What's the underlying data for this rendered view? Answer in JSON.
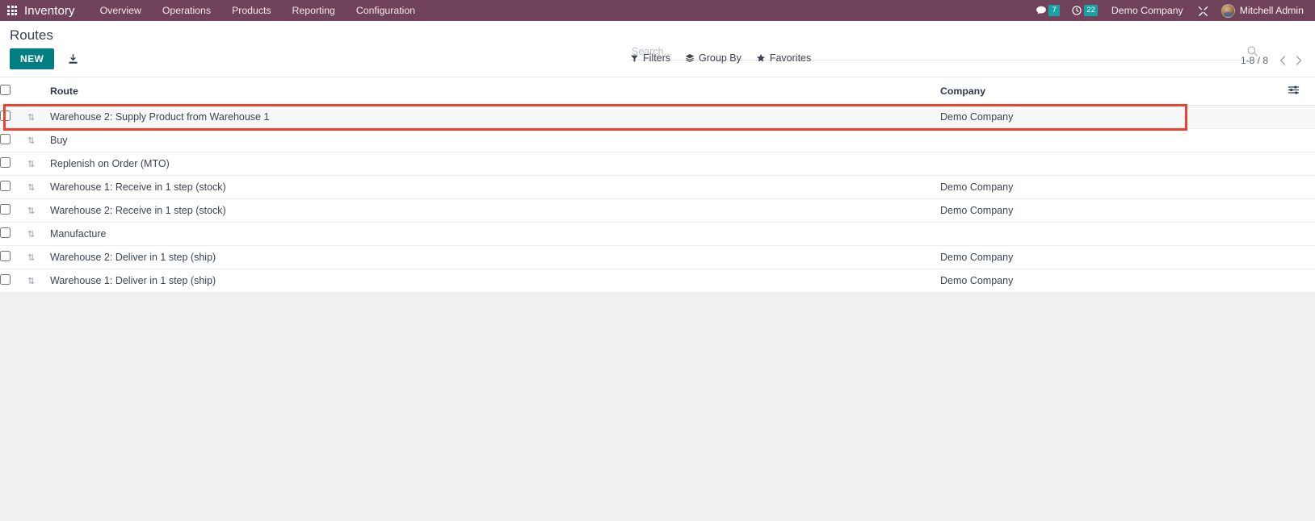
{
  "navbar": {
    "apps_icon": "apps-grid-icon",
    "brand": "Inventory",
    "menu": [
      {
        "label": "Overview"
      },
      {
        "label": "Operations"
      },
      {
        "label": "Products"
      },
      {
        "label": "Reporting"
      },
      {
        "label": "Configuration"
      }
    ],
    "messages": {
      "icon": "chat-bubble-icon",
      "count": "7"
    },
    "activities": {
      "icon": "clock-icon",
      "count": "22"
    },
    "company": "Demo Company",
    "debug": {
      "icon": "tools-wrench-icon"
    },
    "user": {
      "avatar": "user-avatar",
      "name": "Mitchell Admin"
    },
    "background_color": "#71435a",
    "badge_color": "#17a2a8"
  },
  "control_panel": {
    "title": "Routes",
    "new_button": "NEW",
    "new_button_color": "#017e84",
    "upload_icon": "upload-import-icon",
    "search": {
      "placeholder": "Search...",
      "value": "",
      "icon": "search-icon"
    },
    "filters": [
      {
        "label": "Filters",
        "icon": "funnel-icon"
      },
      {
        "label": "Group By",
        "icon": "layers-icon"
      },
      {
        "label": "Favorites",
        "icon": "star-icon"
      }
    ],
    "pager": {
      "range": "1-8 / 8",
      "prev_icon": "chevron-left-icon",
      "next_icon": "chevron-right-icon"
    }
  },
  "list": {
    "columns": {
      "route": "Route",
      "company": "Company"
    },
    "optional_columns_icon": "column-options-icon",
    "select_all_checkbox": false,
    "rows": [
      {
        "route": "Warehouse 2: Supply Product from Warehouse 1",
        "company": "Demo Company",
        "selected": false,
        "highlighted": true
      },
      {
        "route": "Buy",
        "company": "",
        "selected": false,
        "highlighted": false
      },
      {
        "route": "Replenish on Order (MTO)",
        "company": "",
        "selected": false,
        "highlighted": false
      },
      {
        "route": "Warehouse 1: Receive in 1 step (stock)",
        "company": "Demo Company",
        "selected": false,
        "highlighted": false
      },
      {
        "route": "Warehouse 2: Receive in 1 step (stock)",
        "company": "Demo Company",
        "selected": false,
        "highlighted": false
      },
      {
        "route": "Manufacture",
        "company": "",
        "selected": false,
        "highlighted": false
      },
      {
        "route": "Warehouse 2: Deliver in 1 step (ship)",
        "company": "Demo Company",
        "selected": false,
        "highlighted": false
      },
      {
        "route": "Warehouse 1: Deliver in 1 step (ship)",
        "company": "Demo Company",
        "selected": false,
        "highlighted": false
      }
    ],
    "handle_icon": "drag-handle-icon",
    "annotation_color": "#f2412a"
  }
}
